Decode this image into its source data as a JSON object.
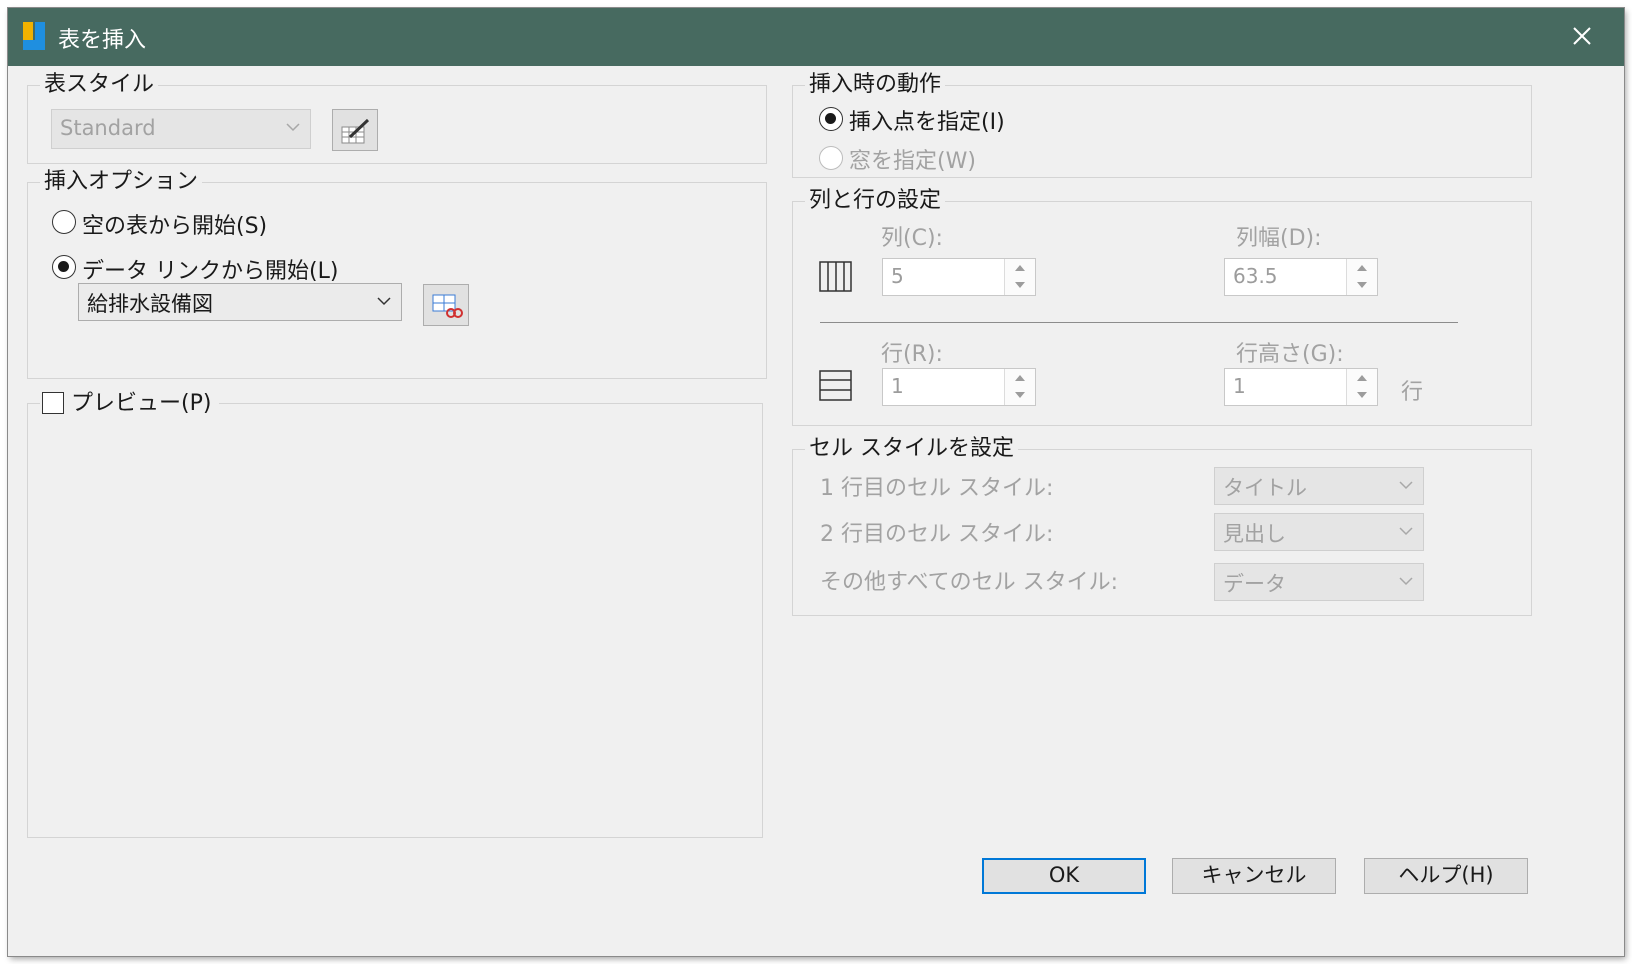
{
  "window": {
    "title": "表を挿入"
  },
  "table_style": {
    "legend": "表スタイル",
    "selected": "Standard"
  },
  "insert_options": {
    "legend": "挿入オプション",
    "radio_empty": "空の表から開始(S)",
    "radio_datalink": "データ リンクから開始(L)",
    "datalink_selected": "給排水設備図"
  },
  "preview": {
    "label": "プレビュー(P)",
    "checked": false
  },
  "insert_behavior": {
    "legend": "挿入時の動作",
    "radio_point": "挿入点を指定(I)",
    "radio_window": "窓を指定(W)"
  },
  "column_row_settings": {
    "legend": "列と行の設定",
    "columns_label": "列(C):",
    "columns_value": "5",
    "column_width_label": "列幅(D):",
    "column_width_value": "63.5",
    "rows_label": "行(R):",
    "rows_value": "1",
    "row_height_label": "行高さ(G):",
    "row_height_value": "1",
    "row_height_unit": "行"
  },
  "cell_styles": {
    "legend": "セル スタイルを設定",
    "row1_label": "1 行目のセル スタイル:",
    "row1_value": "タイトル",
    "row2_label": "2 行目のセル スタイル:",
    "row2_value": "見出し",
    "others_label": "その他すべてのセル スタイル:",
    "others_value": "データ"
  },
  "buttons": {
    "ok": "OK",
    "cancel": "キャンセル",
    "help": "ヘルプ(H)"
  },
  "colors": {
    "titlebar": "#476a60",
    "dialog_bg": "#f0f0f0",
    "default_button_border": "#0078d7"
  }
}
